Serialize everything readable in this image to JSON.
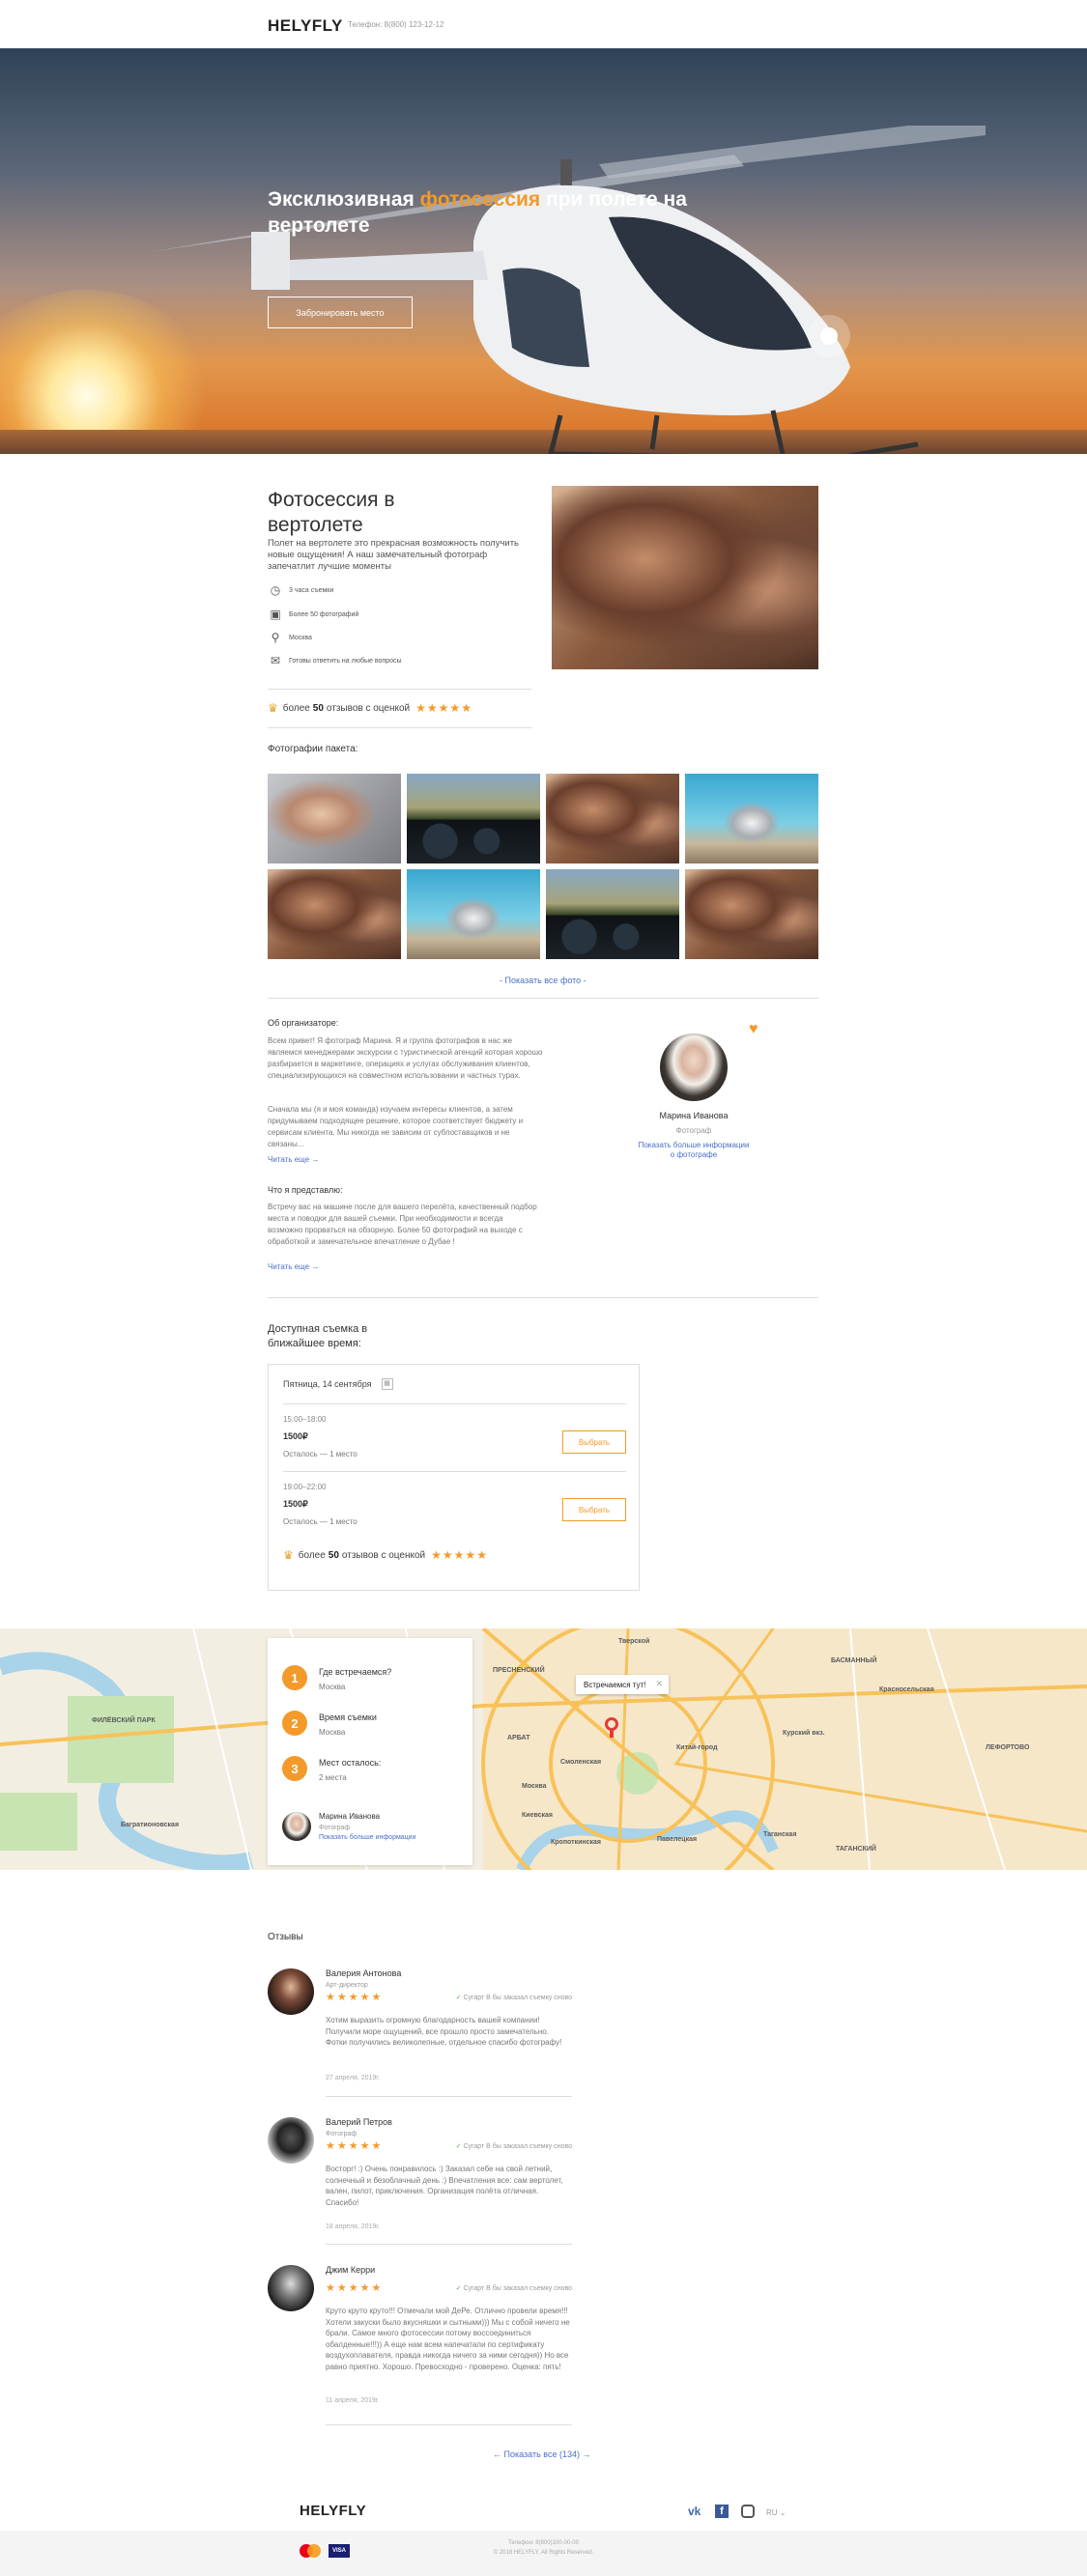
{
  "header": {
    "logo": "HELYFLY",
    "phone": "Телефон: 8(800) 123-12-12"
  },
  "hero": {
    "title_part1": "Эксклюзивная ",
    "title_accent": "фотосессия",
    "title_part2": " при полете на вертолете",
    "button": "Забронировать место"
  },
  "intro": {
    "title": "Фотосессия в вертолете",
    "text": "Полет на вертолете это прекрасная возможность получить новые ощущения! А наш замечательный фотограф запечатлит лучшие моменты",
    "features": [
      {
        "icon": "clock-icon",
        "label": "3 часа съемки"
      },
      {
        "icon": "camera-icon",
        "label": "Более 50 фотографий"
      },
      {
        "icon": "location-icon",
        "label": "Москва"
      },
      {
        "icon": "chat-icon",
        "label": "Готовы ответить на любые вопросы"
      }
    ],
    "rating": {
      "prefix": "более",
      "count": "50",
      "suffix": "отзывов с оценкой",
      "stars": "★★★★★"
    }
  },
  "gallery": {
    "title": "Фотографии пакета:",
    "show_all": "- Показать все фото -"
  },
  "organizer": {
    "title": "Об организаторе:",
    "text1": "Всем привет! Я фотограф Марина. Я и группа фотографов в нас же являемся менеджерами экскурсии с туристической агенций которая хорошо разбирается в маркетинге, операциях и услугах обслуживания клиентов, специализирующихся на совместном использовании и частных турах.",
    "text2": "Сначала мы (я и моя команда) изучаем интересы клиентов, а затем придумываем подходящее решение, которое соответствует бюджету и сервисам клиента. Мы никогда не зависим от субпоставщиков и не связаны...",
    "read_more": "Читать еще →",
    "name": "Марина Иванова",
    "role": "Фотограф",
    "more_info": "Показать больше информации о фотографе"
  },
  "expect": {
    "title": "Что я представлю:",
    "text": "Встречу вас на машине после для вашего перелёта, качественный подбор места и поводки для вашей съемки. При необходимости и всегда возможно прорваться на обзорную. Более 50 фотографий на выходе с обработкой и замечательное впечатление о Дубае !",
    "read_more": "Читать еще →"
  },
  "schedule": {
    "title": "Доступная съемка в ближайшее время:",
    "date": "Пятница, 14 сентября",
    "slots": [
      {
        "time": "15:00–18:00",
        "price": "1500₽",
        "left": "Осталось — 1 место",
        "button": "Выбрать"
      },
      {
        "time": "19:00–22:00",
        "price": "1500₽",
        "left": "Осталось — 1 место",
        "button": "Выбрать"
      }
    ],
    "rating": {
      "prefix": "более",
      "count": "50",
      "suffix": "отзывов с оценкой",
      "stars": "★★★★★"
    }
  },
  "map": {
    "steps": [
      {
        "num": "1",
        "question": "Где встречаемся?",
        "answer": "Москва"
      },
      {
        "num": "2",
        "question": "Время съемки",
        "answer": "Москва"
      },
      {
        "num": "3",
        "question": "Мест осталось:",
        "answer": "2 места"
      }
    ],
    "organizer_name": "Марина Иванова",
    "organizer_role": "Фотограф",
    "organizer_more": "Показать больше информации",
    "bubble": "Встречаемся тут!",
    "labels": [
      "ФИЛЁВСКИЙ ПАРК",
      "БАСМАННЫЙ",
      "ЛЕФОРТОВО",
      "АРБАТ",
      "ТАГАНСКИЙ",
      "Москва",
      "Багратионовская",
      "Киевская",
      "Смоленская",
      "Красносельская",
      "Курский вкз.",
      "Таганская",
      "Кропоткинская",
      "Павелецкая",
      "Китай-город",
      "Тверской",
      "ПРЕСНЕНСКИЙ"
    ]
  },
  "reviews": {
    "title": "Отзывы",
    "items": [
      {
        "name": "Валерия Антонова",
        "role": "Арт-директор",
        "stars": "★★★★★",
        "verify": "Сугарт В бы заказал съемку сново",
        "text": "Хотим выразить огромную благодарность вашей компании! Получили море ощущений, все прошло просто замечательно. Фотки получились великолепные, отдельное спасибо фотографу!",
        "date": "27 апреля, 2019г."
      },
      {
        "name": "Валерий Петров",
        "role": "Фотограф",
        "stars": "★★★★★",
        "verify": "Сугарт В бы заказал съемку сново",
        "text": "Восторг! :) Очень понравилось :) Заказал себе на свой летний, солнечный и безоблачный день :) Впечатления все: сам вертолет, вален, пилот, приключения. Организация полёта отличная. Спасибо!",
        "date": "18 апреля, 2019г."
      },
      {
        "name": "Джим Керри",
        "role": "",
        "stars": "★★★★★",
        "verify": "Сугарт В бы заказал съемку сново",
        "text": "Круто круто круто!!! Отмечали мой ДеРе. Отлично провели время!!! Хотели закуски было вкусняшки и сытными))) Мы с собой ничего не брали. Самое много фотосессии потому воссоединиться обалденные!!!)) А еще нам всем напечатали по сертификату воздухоплавателя, правда никогда ничего за ними сегодня)) Но все равно приятно. Хорошо. Превосходно - проверено. Оценка: пять!",
        "date": "11 апреля, 2019г."
      }
    ],
    "show_all": "← Показать все (134) →"
  },
  "footer": {
    "logo": "HELYFLY",
    "social": [
      "vk-icon",
      "facebook-icon",
      "instagram-icon"
    ],
    "lang": "RU ⌄",
    "phone": "Телефон: 8(800)100-00-00",
    "copyright": "© 2018 HELYFLY. All Rights Reserved.",
    "payments": [
      "mastercard-icon",
      "visa-icon"
    ],
    "visa": "VISA"
  },
  "colors": {
    "accent": "#f39a2a",
    "link": "#4a6fc9"
  }
}
